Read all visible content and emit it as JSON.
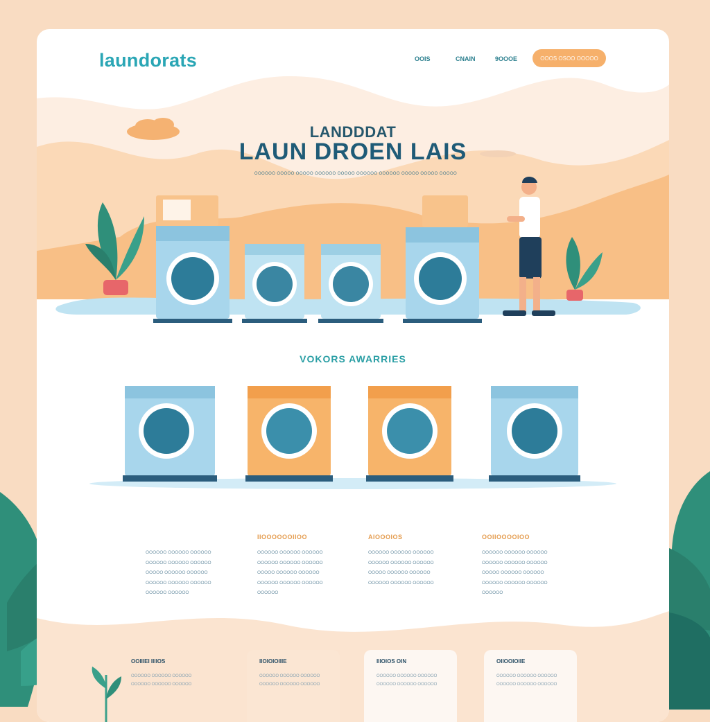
{
  "header": {
    "logo": "laundorats",
    "nav": [
      "OOIS",
      "CNAIN",
      "9OOOE"
    ],
    "cta_label": "OOOS OSOO OOOOO"
  },
  "hero": {
    "eyebrow": "LANDDDAT",
    "title": "LAUN DROEN LAIS",
    "subtitle": "OOOOOO OOOOO OOOOO OOOOOO OOOOO OOOOOO OOOOOO OOOOO OOOOO OOOOO"
  },
  "features": {
    "title": "VOKORS AWARRIES",
    "columns": [
      {
        "heading": "",
        "text": "OOOOOO OOOOOO OOOOOO OOOOOO OOOOOO OOOOOO OOOOO OOOOOO OOOOOO OOOOOO OOOOOO OOOOOO OOOOOO OOOOOO"
      },
      {
        "heading": "IIOOOOOOIIOO",
        "text": "OOOOOO OOOOOO OOOOOO OOOOOO OOOOOO OOOOOO OOOOO OOOOOO OOOOOO OOOOOO OOOOOO OOOOOO OOOOOO"
      },
      {
        "heading": "AIOOOIOS",
        "text": "OOOOOO OOOOOO OOOOOO OOOOOO OOOOOO OOOOOO OOOOO OOOOOO OOOOOO OOOOOO OOOOOO OOOOOO"
      },
      {
        "heading": "OOIIOOOOIOO",
        "text": "OOOOOO OOOOOO OOOOOO OOOOOO OOOOOO OOOOOO OOOOO OOOOOO OOOOOO OOOOOO OOOOOO OOOOOO OOOOOO"
      }
    ]
  },
  "cards": [
    {
      "title": "OOIIIEI IIIIOS",
      "text": "OOOOOO OOOOOO OOOOOO OOOOOO OOOOOO OOOOOO"
    },
    {
      "title": "IIOIOIOIIIE",
      "text": "OOOOOO OOOOOO OOOOOO OOOOOO OOOOOO OOOOOO"
    },
    {
      "title": "IIIOIOS OIN",
      "text": "OOOOOO OOOOOO OOOOOO OOOOOO OOOOOO OOOOOO"
    },
    {
      "title": "OIIOOIOIIE",
      "text": "OOOOOO OOOOOO OOOOOO OOOOOO OOOOOO OOOOOO"
    }
  ],
  "colors": {
    "brand": "#2aa6b5",
    "accent": "#f6b06b",
    "machine_blue": "#a8d6ec",
    "machine_orange": "#f7b46a",
    "heading_dark": "#1f5b77"
  },
  "icons": [
    "plant-icon",
    "washing-machine-icon",
    "person-figure",
    "leaf-icon",
    "cloud-icon"
  ]
}
